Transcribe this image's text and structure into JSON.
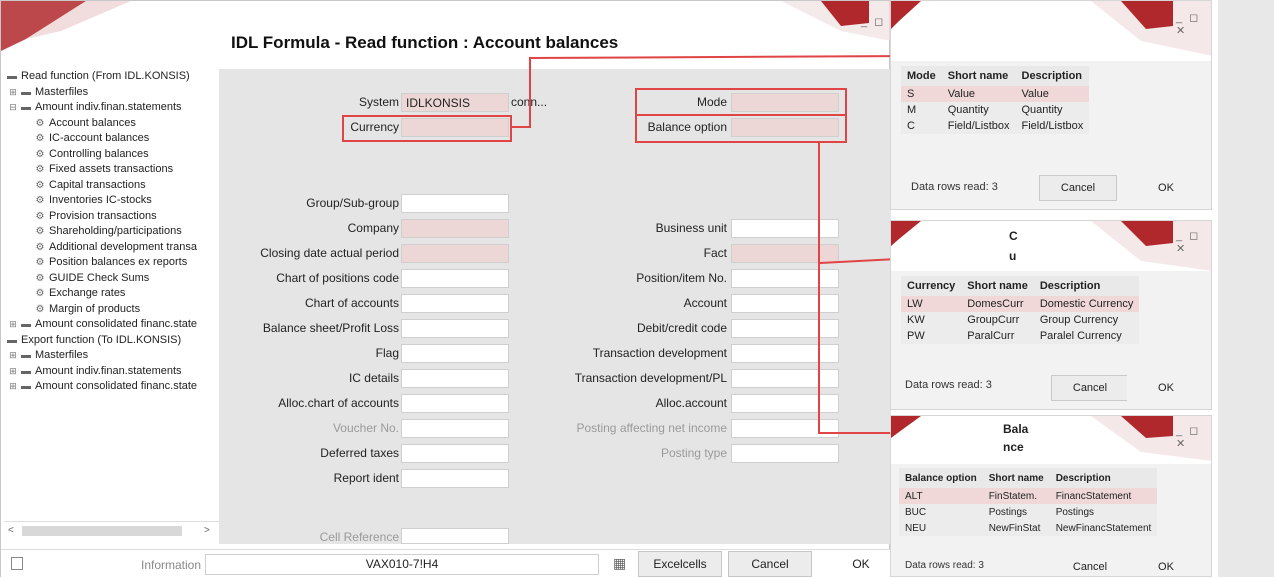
{
  "main": {
    "title": "IDL Formula - Read function : Account balances",
    "window_controls": "_ ◻",
    "tree": [
      {
        "label": "Read function (From IDL.KONSIS)",
        "level": 0,
        "icon": "folder-icon",
        "glyph": ""
      },
      {
        "label": "Masterfiles",
        "level": 1,
        "icon": "folder-icon",
        "glyph": "⊞"
      },
      {
        "label": "Amount indiv.finan.statements",
        "level": 1,
        "icon": "folder-icon",
        "glyph": "⊟"
      },
      {
        "label": "Account balances",
        "level": 2,
        "icon": "gear-icon",
        "glyph": ""
      },
      {
        "label": "IC-account balances",
        "level": 2,
        "icon": "gear-icon",
        "glyph": ""
      },
      {
        "label": "Controlling balances",
        "level": 2,
        "icon": "gear-icon",
        "glyph": ""
      },
      {
        "label": "Fixed assets transactions",
        "level": 2,
        "icon": "gear-icon",
        "glyph": ""
      },
      {
        "label": "Capital transactions",
        "level": 2,
        "icon": "gear-icon",
        "glyph": ""
      },
      {
        "label": "Inventories IC-stocks",
        "level": 2,
        "icon": "gear-icon",
        "glyph": ""
      },
      {
        "label": "Provision transactions",
        "level": 2,
        "icon": "gear-icon",
        "glyph": ""
      },
      {
        "label": "Shareholding/participations",
        "level": 2,
        "icon": "gear-icon",
        "glyph": ""
      },
      {
        "label": "Additional development transa",
        "level": 2,
        "icon": "gear-icon",
        "glyph": ""
      },
      {
        "label": "Position balances ex reports",
        "level": 2,
        "icon": "gear-icon",
        "glyph": ""
      },
      {
        "label": "GUIDE Check Sums",
        "level": 2,
        "icon": "gear-icon",
        "glyph": ""
      },
      {
        "label": "Exchange rates",
        "level": 2,
        "icon": "gear-icon",
        "glyph": ""
      },
      {
        "label": "Margin of products",
        "level": 2,
        "icon": "gear-icon",
        "glyph": ""
      },
      {
        "label": "Amount consolidated financ.state",
        "level": 1,
        "icon": "folder-icon",
        "glyph": "⊞"
      },
      {
        "label": "Export function (To IDL.KONSIS)",
        "level": 0,
        "icon": "folder-icon",
        "glyph": ""
      },
      {
        "label": "Masterfiles",
        "level": 1,
        "icon": "folder-icon",
        "glyph": "⊞"
      },
      {
        "label": "Amount indiv.finan.statements",
        "level": 1,
        "icon": "folder-icon",
        "glyph": "⊞"
      },
      {
        "label": "Amount consolidated financ.state",
        "level": 1,
        "icon": "folder-icon",
        "glyph": "⊞"
      }
    ],
    "form": {
      "system_label": "System",
      "system_value": "IDLKONSIS",
      "system_suffix": "conn...",
      "currency_label": "Currency",
      "mode_label": "Mode",
      "balance_option_label": "Balance option",
      "left_fields": [
        "Group/Sub-group",
        "Company",
        "Closing date actual period",
        "Chart of positions code",
        "Chart of accounts",
        "Balance sheet/Profit  Loss",
        "Flag",
        "IC details",
        "Alloc.chart of accounts",
        "Voucher No.",
        "Deferred taxes",
        "Report ident"
      ],
      "right_fields": [
        "Business unit",
        "Fact",
        "Position/item No.",
        "Account",
        "Debit/credit code",
        "Transaction development",
        "Transaction development/PL",
        "Alloc.account",
        "Posting affecting net income",
        "Posting type"
      ],
      "cell_reference_label": "Cell Reference"
    },
    "statusbar": {
      "information_label": "Information",
      "information_value": "VAX010-7!H4",
      "excelcells_label": "Excelcells",
      "cancel_label": "Cancel",
      "ok_label": "OK"
    }
  },
  "popups": {
    "mode": {
      "headers": [
        "Mode",
        "Short name",
        "Description"
      ],
      "rows": [
        [
          "S",
          "Value",
          "Value"
        ],
        [
          "M",
          "Quantity",
          "Quantity"
        ],
        [
          "C",
          "Field/Listbox",
          "Field/Listbox"
        ]
      ],
      "rows_read": "Data rows read: 3",
      "cancel": "Cancel",
      "ok": "OK"
    },
    "currency": {
      "title_line1": "C",
      "title_line2": "u",
      "headers": [
        "Currency",
        "Short name",
        "Description"
      ],
      "rows": [
        [
          "LW",
          "DomesCurr",
          "Domestic Currency"
        ],
        [
          "KW",
          "GroupCurr",
          "Group Currency"
        ],
        [
          "PW",
          "ParalCurr",
          "Paralel Currency"
        ]
      ],
      "rows_read": "Data rows read: 3",
      "cancel": "Cancel",
      "ok": "OK"
    },
    "balance": {
      "title_line1": "Bala",
      "title_line2": "nce",
      "headers": [
        "Balance option",
        "Short name",
        "Description"
      ],
      "rows": [
        [
          "ALT",
          "FinStatem.",
          "FinancStatement"
        ],
        [
          "BUC",
          "Postings",
          "Postings"
        ],
        [
          "NEU",
          "NewFinStat",
          "NewFinancStatement"
        ]
      ],
      "rows_read": "Data rows read: 3",
      "cancel": "Cancel",
      "ok": "OK"
    },
    "window_controls": "_ ◻ ✕"
  },
  "colors": {
    "accent_red": "#e04444",
    "pink_field": "#edd6d6",
    "deco_red": "#b0282c"
  }
}
